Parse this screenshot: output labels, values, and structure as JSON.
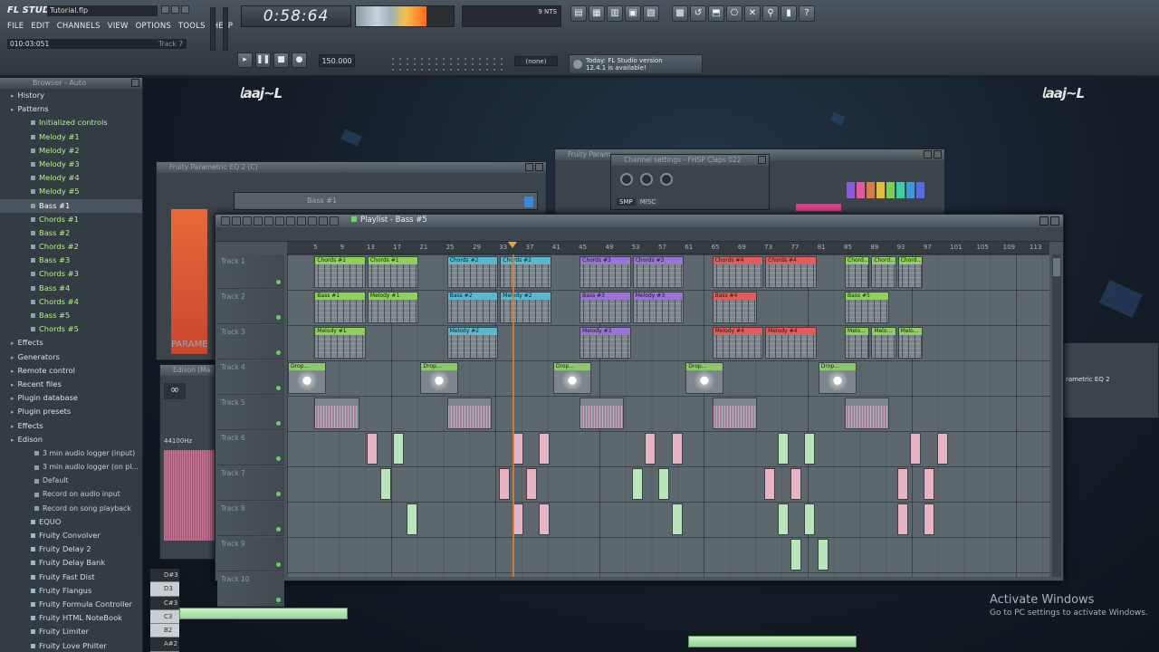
{
  "app": {
    "logo": "FL STUDIO",
    "filename": "Tutorial.flp",
    "menu": [
      "FILE",
      "EDIT",
      "CHANNELS",
      "VIEW",
      "OPTIONS",
      "TOOLS",
      "HELP"
    ],
    "hint_time": "010:03:051",
    "hint_track": "Track 7",
    "time": "0:58:64",
    "cpu_percent": 72,
    "mem_numbers": "9   NTS",
    "bpm": "150.000",
    "snap": "(none)",
    "news_line1": "Today: FL Studio version",
    "news_line2": "12.4.1 is available!"
  },
  "toolbar_icons": [
    "mixer-icon",
    "playlist-icon",
    "pianoroll-icon",
    "channel-icon",
    "browser-icon",
    "plugin-icon",
    "undo-icon",
    "save-icon",
    "render-icon",
    "tools-icon",
    "link-icon",
    "cpu-icon",
    "help-icon"
  ],
  "browser": {
    "title": "Browser - Auto",
    "items": [
      {
        "label": "History",
        "kind": "folder"
      },
      {
        "label": "Patterns",
        "kind": "folder"
      },
      {
        "label": "Initialized controls",
        "kind": "pattern"
      },
      {
        "label": "Melody #1",
        "kind": "pattern"
      },
      {
        "label": "Melody #2",
        "kind": "pattern"
      },
      {
        "label": "Melody #3",
        "kind": "pattern"
      },
      {
        "label": "Melody #4",
        "kind": "pattern"
      },
      {
        "label": "Melody #5",
        "kind": "pattern"
      },
      {
        "label": "Bass #1",
        "kind": "pattern-selected"
      },
      {
        "label": "Chords #1",
        "kind": "pattern"
      },
      {
        "label": "Bass #2",
        "kind": "pattern"
      },
      {
        "label": "Chords #2",
        "kind": "pattern"
      },
      {
        "label": "Bass #3",
        "kind": "pattern"
      },
      {
        "label": "Chords #3",
        "kind": "pattern"
      },
      {
        "label": "Bass #4",
        "kind": "pattern"
      },
      {
        "label": "Chords #4",
        "kind": "pattern"
      },
      {
        "label": "Bass #5",
        "kind": "pattern"
      },
      {
        "label": "Chords #5",
        "kind": "pattern"
      },
      {
        "label": "Effects",
        "kind": "folder"
      },
      {
        "label": "Generators",
        "kind": "folder"
      },
      {
        "label": "Remote control",
        "kind": "folder"
      },
      {
        "label": "Recent files",
        "kind": "folder"
      },
      {
        "label": "Plugin database",
        "kind": "folder"
      },
      {
        "label": "Plugin presets",
        "kind": "folder"
      },
      {
        "label": "Effects",
        "kind": "folder"
      },
      {
        "label": "Edison",
        "kind": "folder"
      },
      {
        "label": "3 min audio logger (input)",
        "kind": "sub"
      },
      {
        "label": "3 min audio logger (on pl...",
        "kind": "sub"
      },
      {
        "label": "Default",
        "kind": "sub"
      },
      {
        "label": "Record on audio input",
        "kind": "sub"
      },
      {
        "label": "Record on song playback",
        "kind": "sub"
      },
      {
        "label": "EQUO",
        "kind": "plugin"
      },
      {
        "label": "Fruity Convolver",
        "kind": "plugin"
      },
      {
        "label": "Fruity Delay 2",
        "kind": "plugin"
      },
      {
        "label": "Fruity Delay Bank",
        "kind": "plugin"
      },
      {
        "label": "Fruity Fast Dist",
        "kind": "plugin"
      },
      {
        "label": "Fruity Flangus",
        "kind": "plugin"
      },
      {
        "label": "Fruity Formula Controller",
        "kind": "plugin"
      },
      {
        "label": "Fruity HTML NoteBook",
        "kind": "plugin"
      },
      {
        "label": "Fruity Limiter",
        "kind": "plugin"
      },
      {
        "label": "Fruity Love Philter",
        "kind": "plugin"
      }
    ]
  },
  "windows": {
    "eq_title": "Fruity Parametric EQ 2 (C)",
    "eq_label": "PARAME",
    "channel_title": "Channel settings - FHSP Claps 022",
    "channel_tabs": [
      "SMP",
      "MISC"
    ],
    "fruity_title": "Fruity Param",
    "edison_title": "Edison (Ma",
    "edison_rate": "44100Hz",
    "bass_title": "Bass #1",
    "right_label": "rametric EQ 2"
  },
  "playlist": {
    "title": "Playlist - Bass #5",
    "ruler": [
      "5",
      "9",
      "13",
      "17",
      "21",
      "25",
      "29",
      "33",
      "37",
      "41",
      "45",
      "49",
      "53",
      "57",
      "61",
      "65",
      "69",
      "73",
      "77",
      "81",
      "85",
      "89",
      "93",
      "97",
      "101",
      "105",
      "109",
      "113"
    ],
    "position_bar": 35,
    "tracks": [
      "Track 1",
      "Track 2",
      "Track 3",
      "Track 4",
      "Track 5",
      "Track 6",
      "Track 7",
      "Track 8",
      "Track 9",
      "Track 10"
    ],
    "clips": [
      {
        "track": 1,
        "start": 5,
        "len": 8,
        "name": "Chords #1",
        "color": "#8fd05c"
      },
      {
        "track": 1,
        "start": 13,
        "len": 8,
        "name": "Chords #1",
        "color": "#8fd05c"
      },
      {
        "track": 1,
        "start": 25,
        "len": 8,
        "name": "Chords #2",
        "color": "#59b8d0"
      },
      {
        "track": 1,
        "start": 33,
        "len": 8,
        "name": "Chords #2",
        "color": "#59b8d0"
      },
      {
        "track": 1,
        "start": 45,
        "len": 8,
        "name": "Chords #3",
        "color": "#9d72d8"
      },
      {
        "track": 1,
        "start": 53,
        "len": 8,
        "name": "Chords #3",
        "color": "#9d72d8"
      },
      {
        "track": 1,
        "start": 65,
        "len": 8,
        "name": "Chords #4",
        "color": "#e35b5b"
      },
      {
        "track": 1,
        "start": 73,
        "len": 8,
        "name": "Chords #4",
        "color": "#e35b5b"
      },
      {
        "track": 1,
        "start": 85,
        "len": 4,
        "name": "Chord...",
        "color": "#8fd05c"
      },
      {
        "track": 1,
        "start": 89,
        "len": 4,
        "name": "Chord...",
        "color": "#8fd05c"
      },
      {
        "track": 1,
        "start": 93,
        "len": 4,
        "name": "Chord...",
        "color": "#8fd05c"
      },
      {
        "track": 2,
        "start": 5,
        "len": 8,
        "name": "Bass #1",
        "color": "#8fd05c"
      },
      {
        "track": 2,
        "start": 13,
        "len": 8,
        "name": "Melody #1",
        "color": "#8fd05c"
      },
      {
        "track": 2,
        "start": 25,
        "len": 8,
        "name": "Bass #2",
        "color": "#59b8d0"
      },
      {
        "track": 2,
        "start": 33,
        "len": 8,
        "name": "Melody #2",
        "color": "#59b8d0"
      },
      {
        "track": 2,
        "start": 45,
        "len": 8,
        "name": "Bass #3",
        "color": "#9d72d8"
      },
      {
        "track": 2,
        "start": 53,
        "len": 8,
        "name": "Melody #3",
        "color": "#9d72d8"
      },
      {
        "track": 2,
        "start": 65,
        "len": 7,
        "name": "Bass #4",
        "color": "#e35b5b"
      },
      {
        "track": 2,
        "start": 85,
        "len": 7,
        "name": "Bass #5",
        "color": "#8fd05c"
      },
      {
        "track": 3,
        "start": 5,
        "len": 8,
        "name": "Melody #1",
        "color": "#8fd05c"
      },
      {
        "track": 3,
        "start": 25,
        "len": 8,
        "name": "Melody #2",
        "color": "#59b8d0"
      },
      {
        "track": 3,
        "start": 45,
        "len": 8,
        "name": "Melody #3",
        "color": "#9d72d8"
      },
      {
        "track": 3,
        "start": 65,
        "len": 8,
        "name": "Melody #4",
        "color": "#e35b5b"
      },
      {
        "track": 3,
        "start": 73,
        "len": 8,
        "name": "Melody #4",
        "color": "#e35b5b"
      },
      {
        "track": 3,
        "start": 85,
        "len": 4,
        "name": "Melo...",
        "color": "#8fd05c"
      },
      {
        "track": 3,
        "start": 89,
        "len": 4,
        "name": "Melo...",
        "color": "#8fd05c"
      },
      {
        "track": 3,
        "start": 93,
        "len": 4,
        "name": "Melo...",
        "color": "#8fd05c"
      }
    ],
    "drum_clips": [
      {
        "track": 4,
        "start": 1,
        "len": 6,
        "name": "Drop..."
      },
      {
        "track": 4,
        "start": 21,
        "len": 6,
        "name": "Drop..."
      },
      {
        "track": 4,
        "start": 41,
        "len": 6,
        "name": "Drop..."
      },
      {
        "track": 4,
        "start": 61,
        "len": 6,
        "name": "Drop..."
      },
      {
        "track": 4,
        "start": 81,
        "len": 6,
        "name": "Drop..."
      }
    ],
    "wave_clips": [
      {
        "track": 5,
        "start": 5,
        "len": 7
      },
      {
        "track": 5,
        "start": 25,
        "len": 7
      },
      {
        "track": 5,
        "start": 45,
        "len": 7
      },
      {
        "track": 5,
        "start": 65,
        "len": 7
      },
      {
        "track": 5,
        "start": 85,
        "len": 7
      }
    ],
    "notes": [
      {
        "track": 6,
        "bar": 13,
        "color": "#e8b4c4"
      },
      {
        "track": 6,
        "bar": 17,
        "color": "#b9e6b8"
      },
      {
        "track": 6,
        "bar": 35,
        "color": "#e8b4c4"
      },
      {
        "track": 6,
        "bar": 39,
        "color": "#e8b4c4"
      },
      {
        "track": 6,
        "bar": 55,
        "color": "#e8b4c4"
      },
      {
        "track": 6,
        "bar": 59,
        "color": "#e8b4c4"
      },
      {
        "track": 6,
        "bar": 75,
        "color": "#b9e6b8"
      },
      {
        "track": 6,
        "bar": 79,
        "color": "#b9e6b8"
      },
      {
        "track": 6,
        "bar": 95,
        "color": "#e8b4c4"
      },
      {
        "track": 6,
        "bar": 99,
        "color": "#e8b4c4"
      },
      {
        "track": 7,
        "bar": 15,
        "color": "#b9e6b8"
      },
      {
        "track": 7,
        "bar": 33,
        "color": "#e8b4c4"
      },
      {
        "track": 7,
        "bar": 37,
        "color": "#e8b4c4"
      },
      {
        "track": 7,
        "bar": 53,
        "color": "#b9e6b8"
      },
      {
        "track": 7,
        "bar": 57,
        "color": "#b9e6b8"
      },
      {
        "track": 7,
        "bar": 73,
        "color": "#e8b4c4"
      },
      {
        "track": 7,
        "bar": 77,
        "color": "#e8b4c4"
      },
      {
        "track": 7,
        "bar": 93,
        "color": "#e8b4c4"
      },
      {
        "track": 7,
        "bar": 97,
        "color": "#e8b4c4"
      },
      {
        "track": 8,
        "bar": 19,
        "color": "#b9e6b8"
      },
      {
        "track": 8,
        "bar": 35,
        "color": "#e8b4c4"
      },
      {
        "track": 8,
        "bar": 39,
        "color": "#e8b4c4"
      },
      {
        "track": 8,
        "bar": 59,
        "color": "#b9e6b8"
      },
      {
        "track": 8,
        "bar": 75,
        "color": "#b9e6b8"
      },
      {
        "track": 8,
        "bar": 79,
        "color": "#b9e6b8"
      },
      {
        "track": 8,
        "bar": 93,
        "color": "#e8b4c4"
      },
      {
        "track": 8,
        "bar": 97,
        "color": "#e8b4c4"
      },
      {
        "track": 9,
        "bar": 77,
        "color": "#b9e6b8"
      },
      {
        "track": 9,
        "bar": 81,
        "color": "#b9e6b8"
      }
    ]
  },
  "piano_keys": [
    "D#3",
    "D3",
    "C#3",
    "C3",
    "B2",
    "A#2"
  ],
  "watermark": {
    "title": "Activate Windows",
    "subtitle": "Go to PC settings to activate Windows."
  }
}
